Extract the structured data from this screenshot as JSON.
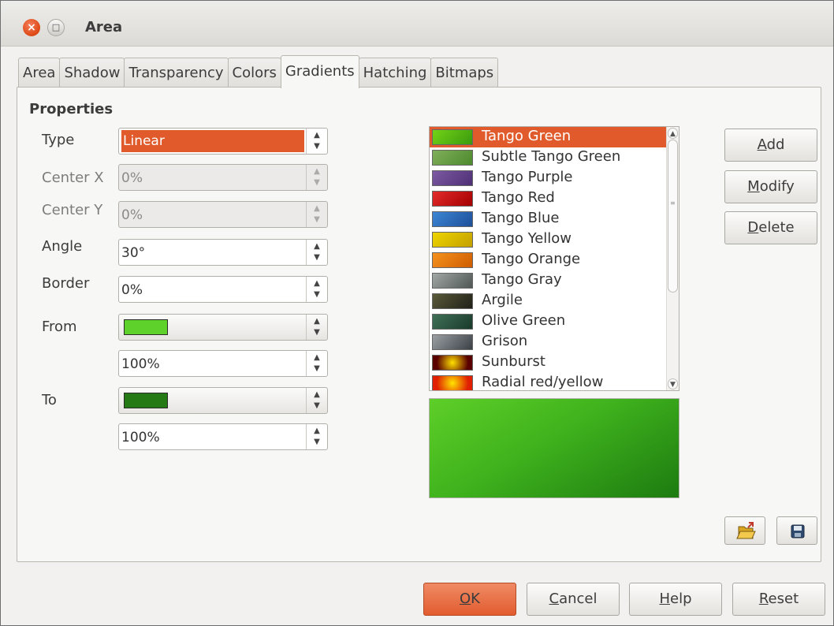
{
  "window": {
    "title": "Area",
    "close_glyph": "×",
    "maximize_glyph": "□"
  },
  "tabs": [
    "Area",
    "Shadow",
    "Transparency",
    "Colors",
    "Gradients",
    "Hatching",
    "Bitmaps"
  ],
  "active_tab": "Gradients",
  "properties": {
    "heading": "Properties",
    "type": {
      "label": "Type",
      "value": "Linear"
    },
    "center_x": {
      "label": "Center X",
      "value": "0%"
    },
    "center_y": {
      "label": "Center Y",
      "value": "0%"
    },
    "angle": {
      "label": "Angle",
      "value": "30°"
    },
    "border": {
      "label": "Border",
      "value": "0%"
    },
    "from": {
      "label": "From",
      "color": "#5ed22a",
      "intensity": "100%"
    },
    "to": {
      "label": "To",
      "color": "#267a16",
      "intensity": "100%"
    }
  },
  "gradients": [
    {
      "name": "Tango Green",
      "c1": "#73d216",
      "c2": "#3a9a0e",
      "selected": true
    },
    {
      "name": "Subtle Tango Green",
      "c1": "#7fae5a",
      "c2": "#4e8a2e"
    },
    {
      "name": "Tango Purple",
      "c1": "#7d5aa3",
      "c2": "#4e2f74"
    },
    {
      "name": "Tango Red",
      "c1": "#e32b2b",
      "c2": "#a40000"
    },
    {
      "name": "Tango Blue",
      "c1": "#3d86d4",
      "c2": "#1d4f99"
    },
    {
      "name": "Tango Yellow",
      "c1": "#edd400",
      "c2": "#c4a000"
    },
    {
      "name": "Tango Orange",
      "c1": "#f5921e",
      "c2": "#ce5c00"
    },
    {
      "name": "Tango Gray",
      "c1": "#a0a7a4",
      "c2": "#505855"
    },
    {
      "name": "Argile",
      "c1": "#5a5a3a",
      "c2": "#202018"
    },
    {
      "name": "Olive Green",
      "c1": "#3f7058",
      "c2": "#1a3a2a"
    },
    {
      "name": "Grison",
      "c1": "#9aa0a4",
      "c2": "#3a4045"
    },
    {
      "name": "Sunburst",
      "c1": "#ffe000",
      "c2": "#5a0000",
      "radial": true
    },
    {
      "name": "Radial red/yellow",
      "c1": "#ffe400",
      "c2": "#e02000",
      "radial": true
    }
  ],
  "buttons": {
    "add": "Add",
    "add_key": "A",
    "modify": "Modify",
    "modify_key": "M",
    "delete": "Delete",
    "delete_key": "D",
    "ok": "OK",
    "ok_key": "O",
    "cancel": "Cancel",
    "cancel_key": "C",
    "help": "Help",
    "help_key": "H",
    "reset": "Reset",
    "reset_key": "R"
  },
  "colors": {
    "accent": "#e05a2b",
    "panel": "#f7f7f6"
  }
}
